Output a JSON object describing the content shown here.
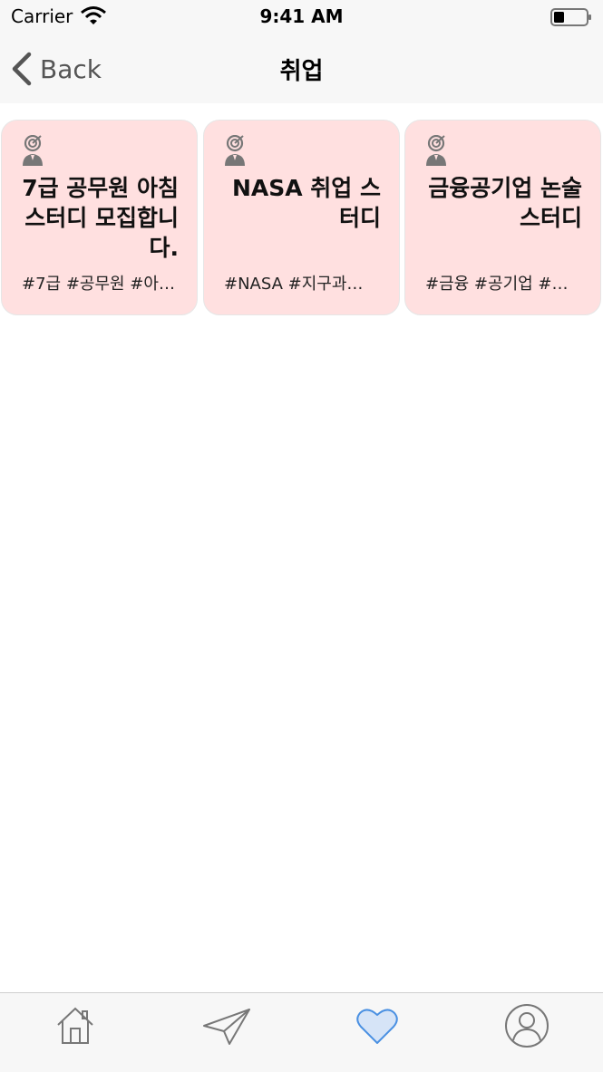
{
  "status_bar": {
    "carrier": "Carrier",
    "time": "9:41 AM"
  },
  "nav": {
    "back_label": "Back",
    "title": "취업"
  },
  "cards": [
    {
      "title": "7급 공무원 아침 스터디 모집합니다.",
      "tags": "#7급 #공무원 #아…"
    },
    {
      "title": "NASA 취업 스터디",
      "tags": "#NASA #지구과…"
    },
    {
      "title": "금융공기업 논술 스터디",
      "tags": "#금융 #공기업 #…"
    }
  ],
  "tab_bar": {
    "tabs": [
      {
        "icon": "home-icon"
      },
      {
        "icon": "paper-plane-icon"
      },
      {
        "icon": "heart-icon",
        "selected": true
      },
      {
        "icon": "profile-icon"
      }
    ]
  },
  "colors": {
    "card_background": "#ffe0e0",
    "accent": "#4a90e2",
    "selected_fill": "#d6e4f7"
  }
}
